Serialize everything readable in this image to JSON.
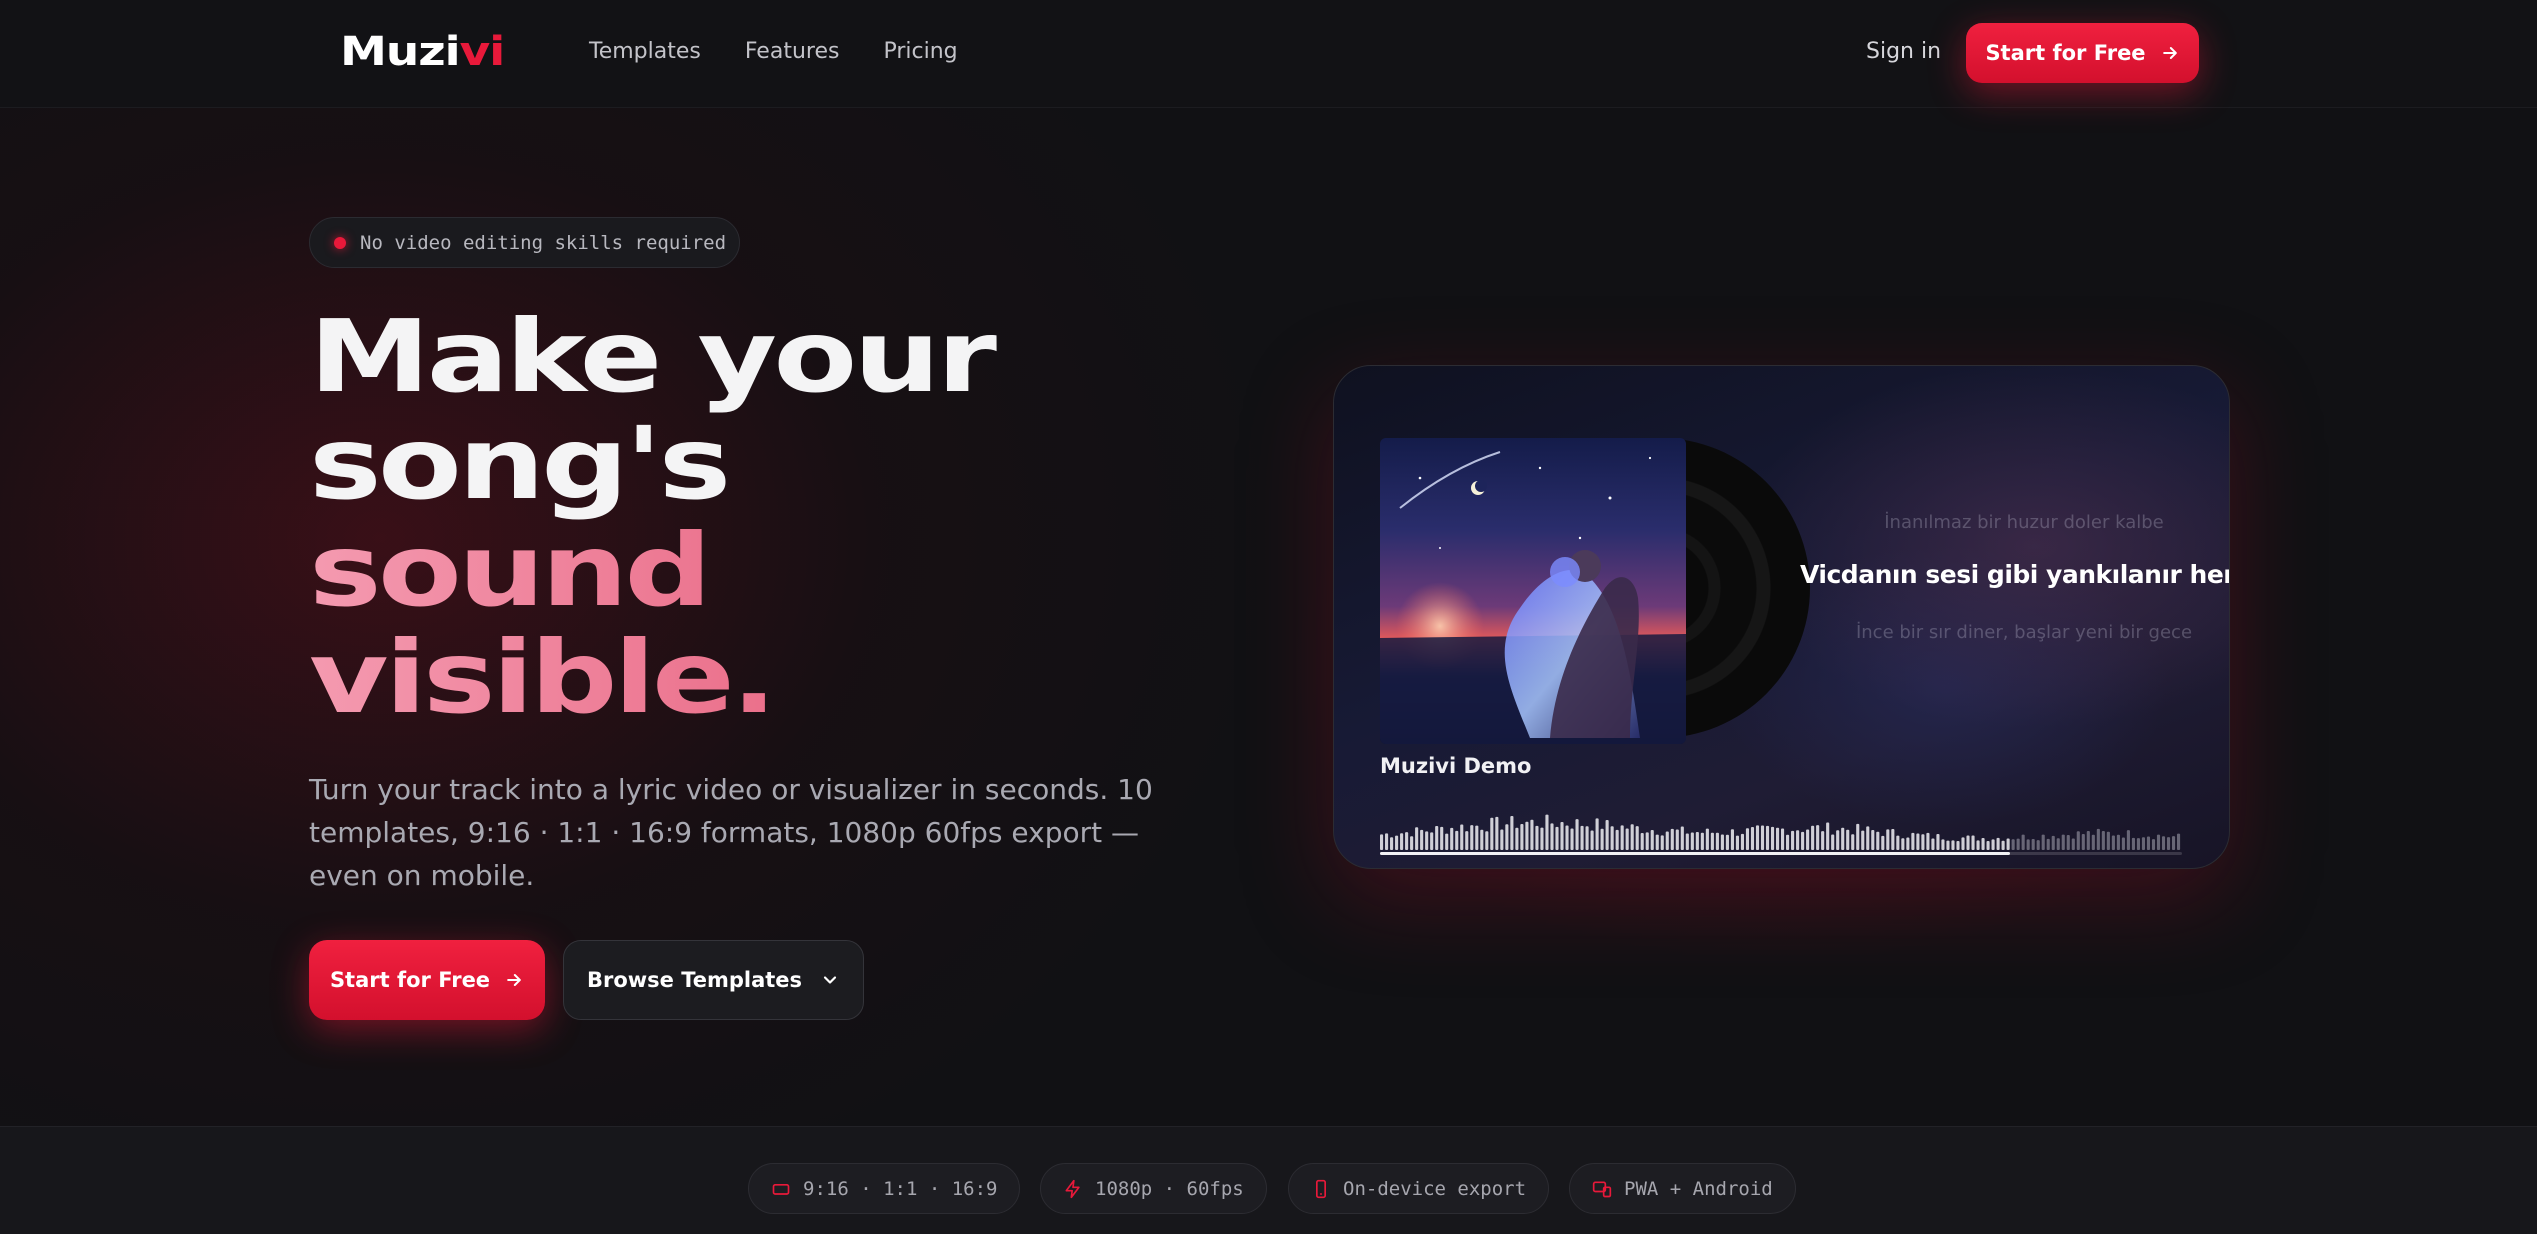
{
  "brand": {
    "logo_a": "Muzi",
    "logo_b": "vi",
    "accent": "#e8193a"
  },
  "nav": {
    "links": [
      {
        "label": "Templates"
      },
      {
        "label": "Features"
      },
      {
        "label": "Pricing"
      }
    ],
    "signin": "Sign in",
    "cta": "Start for Free"
  },
  "hero": {
    "badge": "No video editing skills required",
    "headline": {
      "l1": "Make your",
      "l2": "song's",
      "l3": "sound",
      "l4": "visible."
    },
    "subtext": "Turn your track into a lyric video or visualizer in seconds. 10 templates, 9:16 · 1:1 · 16:9 formats, 1080p 60fps export — even on mobile.",
    "cta_primary": "Start for Free",
    "cta_secondary": "Browse Templates"
  },
  "preview": {
    "track_title": "Muzivi Demo",
    "lyric_prev": "İnanılmaz bir huzur doler kalbe",
    "lyric_current": "Vicdanın sesi gibi yankılanır her hece",
    "lyric_next": "İnce bir sır diner, başlar yeni bir gece",
    "progress": 0.785
  },
  "features": [
    {
      "icon": "aspect-ratio-icon",
      "label": "9:16 · 1:1 · 16:9"
    },
    {
      "icon": "bolt-icon",
      "label": "1080p · 60fps"
    },
    {
      "icon": "phone-icon",
      "label": "On-device export"
    },
    {
      "icon": "devices-icon",
      "label": "PWA + Android"
    }
  ]
}
